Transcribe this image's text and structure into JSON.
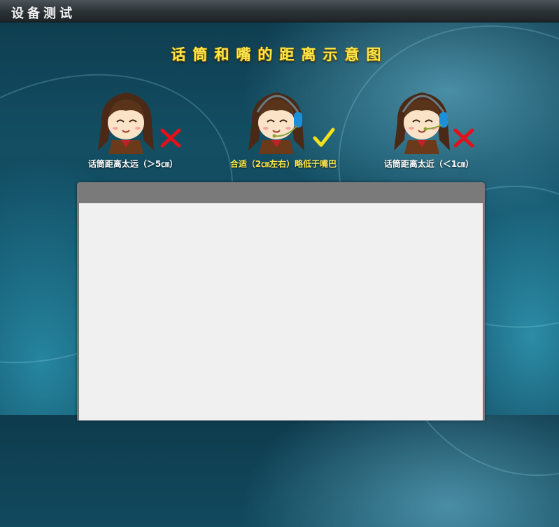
{
  "window": {
    "title": "设备测试"
  },
  "heading": "话筒和嘴的距离示意图",
  "figures": [
    {
      "caption": "话筒距离太远（＞5㎝）",
      "caption_color": "#ffffff",
      "mark": "cross-icon",
      "headset": false
    },
    {
      "caption": "合适（2㎝左右）略低于嘴巴",
      "caption_color": "#ffe84a",
      "mark": "check-icon",
      "headset": true
    },
    {
      "caption": "话筒距离太近（＜1㎝）",
      "caption_color": "#ffffff",
      "mark": "cross-icon",
      "headset": true
    }
  ],
  "colors": {
    "heading": "#ffe84a",
    "cross": "#e0121b",
    "check": "#f5e11a",
    "headset": "#1c8fd8",
    "panel_header": "#7a7a7a",
    "panel_body": "#f0f0f0"
  }
}
